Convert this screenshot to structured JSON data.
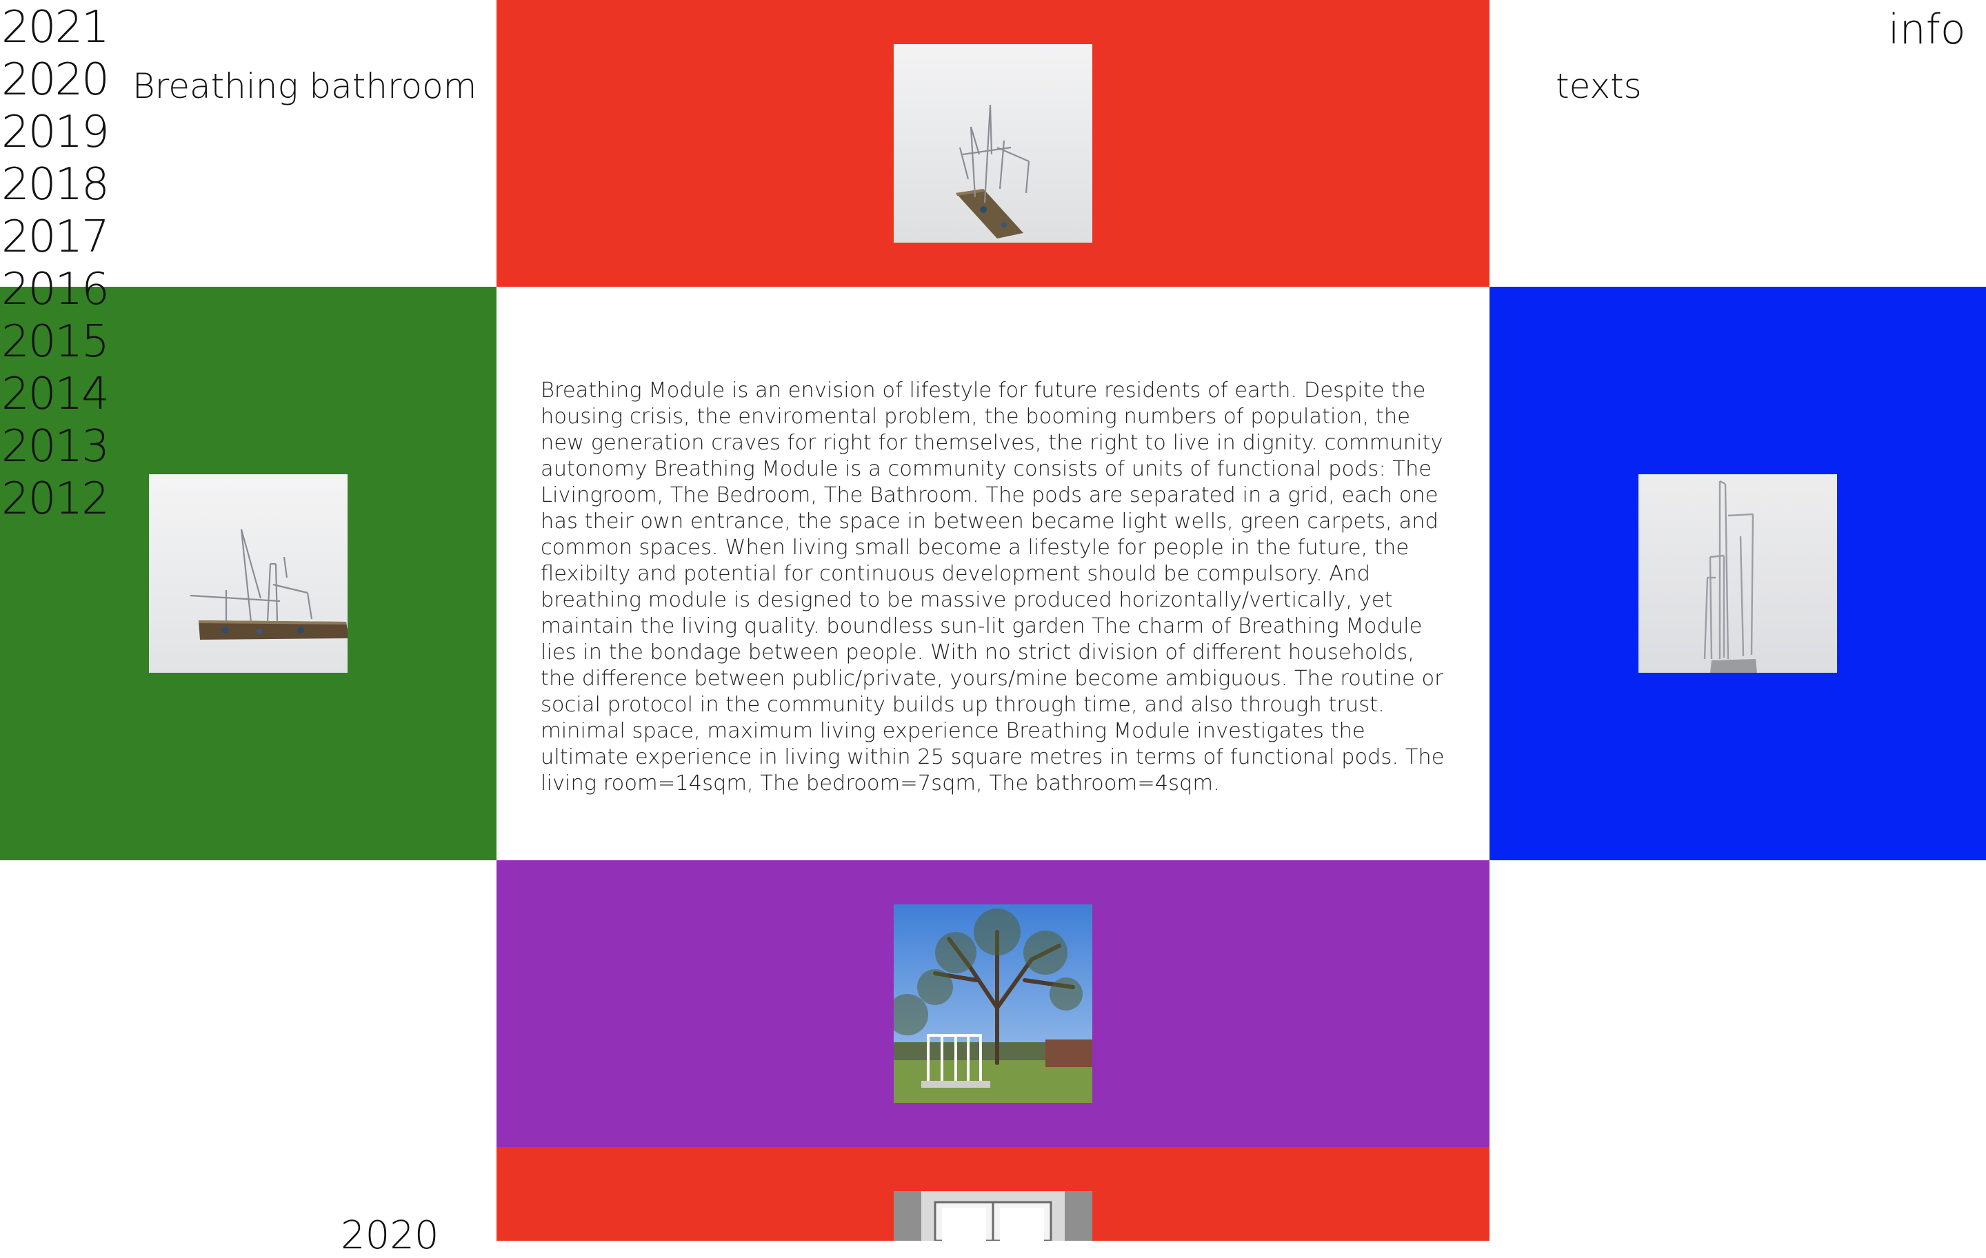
{
  "nav": {
    "years": [
      "2021",
      "2020",
      "2019",
      "2018",
      "2017",
      "2016",
      "2015",
      "2014",
      "2013",
      "2012"
    ],
    "project_title": "Breathing bathroom",
    "texts_label": "texts",
    "info_label": "info",
    "footer_year": "2020"
  },
  "colors": {
    "red": "#EC3425",
    "green": "#348024",
    "blue": "#0623F5",
    "purple": "#9330B8",
    "white": "#FFFFFF"
  },
  "tiles": [
    {
      "name": "model-photo-top",
      "subject": "wire sculpture on a thin wooden base"
    },
    {
      "name": "model-photo-left",
      "subject": "wire sculpture on a long wooden board"
    },
    {
      "name": "model-photo-right",
      "subject": "tall bent-wire sculpture"
    },
    {
      "name": "garden-photo",
      "subject": "tree in a garden with a white frame structure"
    },
    {
      "name": "window-photo",
      "subject": "interior window view"
    }
  ],
  "description": "Breathing Module is an envision of lifestyle for future residents of earth. Despite the housing crisis, the enviromental problem, the booming numbers of population, the new generation craves for right for themselves, the right to live in dignity. community autonomy Breathing Module is a community consists of units of functional pods: The Livingroom, The Bedroom, The Bathroom. The pods are separated in a grid, each one has their own entrance, the space in between became light wells, green carpets, and common spaces. When living small become a lifestyle for people in the future, the flexibilty and potential for continuous development should be compulsory. And breathing module is designed to be massive produced horizontally/vertically, yet maintain the living quality. boundless sun-lit garden The charm of Breathing Module lies in the bondage between people. With no strict division of different households, the difference between public/private, yours/mine become ambiguous. The routine or social protocol in the community builds up through time, and also through trust. minimal space, maximum living experience Breathing Module investigates the ultimate experience in living within 25 square metres in terms of functional pods. The living room=14sqm, The bedroom=7sqm, The bathroom=4sqm."
}
